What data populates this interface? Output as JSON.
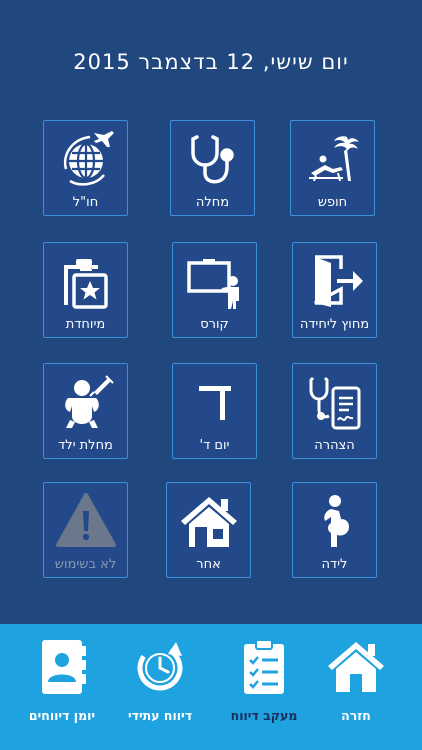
{
  "header": {
    "date": "יום שישי, 12 בדצמבר 2015"
  },
  "tiles": [
    {
      "label": "חופש",
      "icon": "beach-vacation-icon"
    },
    {
      "label": "מחלה",
      "icon": "stethoscope-icon"
    },
    {
      "label": "חו\"ל",
      "icon": "globe-plane-icon"
    },
    {
      "label": "מחוץ ליחידה",
      "icon": "exit-door-icon"
    },
    {
      "label": "קורס",
      "icon": "teacher-board-icon"
    },
    {
      "label": "מיוחדת",
      "icon": "clipboard-star-icon"
    },
    {
      "label": "הצהרה",
      "icon": "medical-declaration-icon"
    },
    {
      "label": "יום ד'",
      "icon": "letter-dalet-icon"
    },
    {
      "label": "מחלת ילד",
      "icon": "baby-injection-icon"
    },
    {
      "label": "לידה",
      "icon": "pregnant-icon"
    },
    {
      "label": "אחר",
      "icon": "house-icon"
    },
    {
      "label": "לא בשימוש",
      "icon": "warning-icon"
    }
  ],
  "bottom_nav": [
    {
      "label": "חזרה",
      "icon": "home-icon"
    },
    {
      "label": "מעקב דיווח",
      "icon": "checklist-icon"
    },
    {
      "label": "דיווח עתידי",
      "icon": "clock-refresh-icon"
    },
    {
      "label": "יומן דיווחים",
      "icon": "contact-book-icon"
    }
  ]
}
